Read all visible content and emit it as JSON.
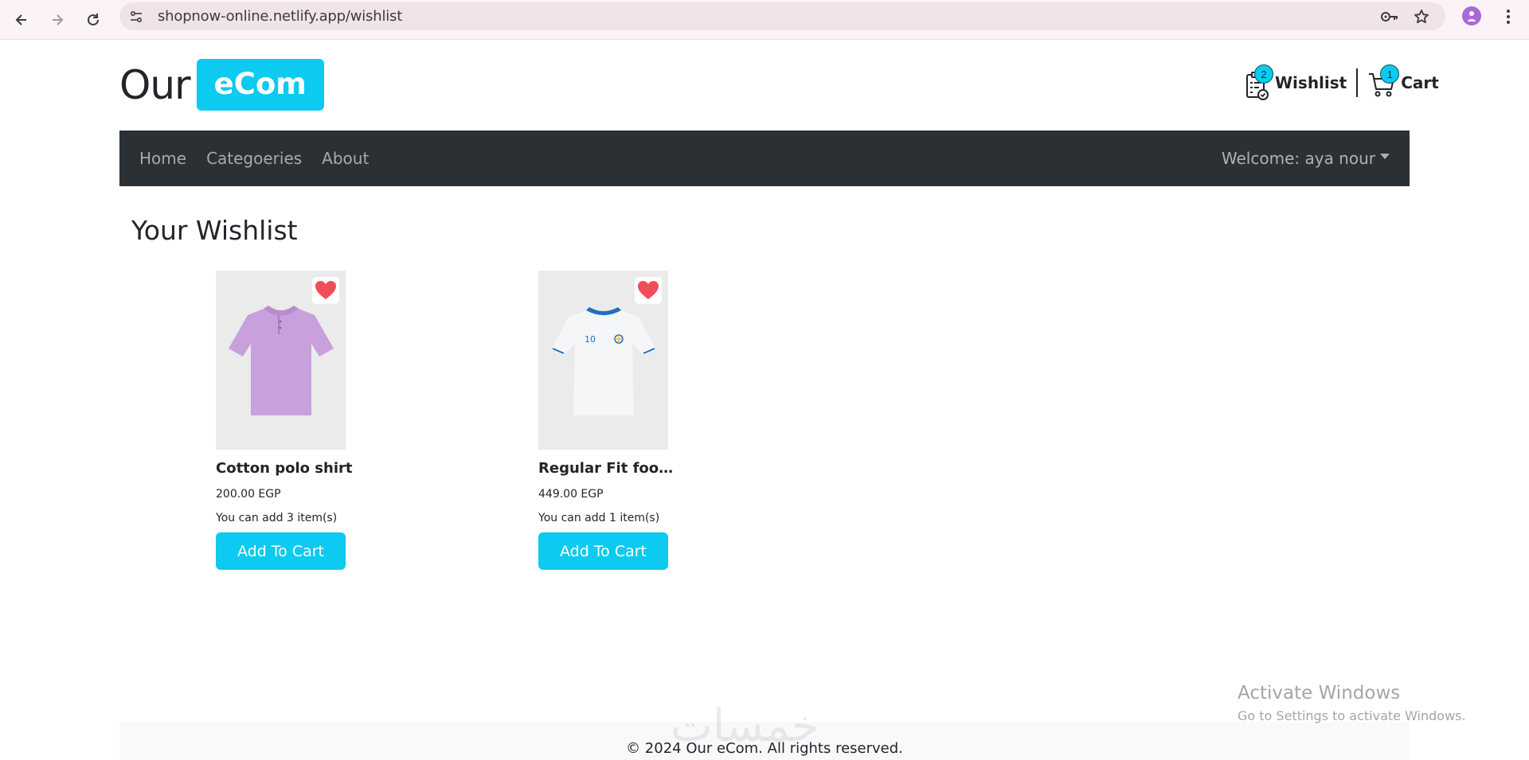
{
  "browser": {
    "url": "shopnow-online.netlify.app/wishlist",
    "icons": [
      "back-arrow-icon",
      "forward-arrow-icon",
      "reload-icon",
      "site-info-icon",
      "password-key-icon",
      "bookmark-star-icon",
      "profile-avatar-icon",
      "more-menu-icon"
    ]
  },
  "header": {
    "logo_text": "Our",
    "logo_badge": "eCom",
    "wishlist": {
      "label": "Wishlist",
      "count": "2",
      "icon": "wishlist-clipboard-icon"
    },
    "cart": {
      "label": "Cart",
      "count": "1",
      "icon": "cart-icon"
    }
  },
  "navbar": {
    "links": [
      "Home",
      "Categoeries",
      "About"
    ],
    "welcome": "Welcome: aya nour"
  },
  "main": {
    "title": "Your Wishlist",
    "products": [
      {
        "title": "Cotton polo shirt",
        "price": "200.00 EGP",
        "stock": "You can add 3 item(s)",
        "button": "Add To Cart",
        "image_color": "#c8a0dd"
      },
      {
        "title": "Regular Fit footb...",
        "price": "449.00 EGP",
        "stock": "You can add 1 item(s)",
        "button": "Add To Cart",
        "image_color": "#f3f4f6"
      }
    ]
  },
  "footer": {
    "text": "© 2024 Our eCom. All rights reserved."
  },
  "overlay": {
    "activate_title": "Activate Windows",
    "activate_sub": "Go to Settings to activate Windows.",
    "watermark": "خمسات"
  },
  "colors": {
    "accent": "#0dcaf0",
    "navbar": "#2b3035",
    "heart": "#f14c5a"
  }
}
